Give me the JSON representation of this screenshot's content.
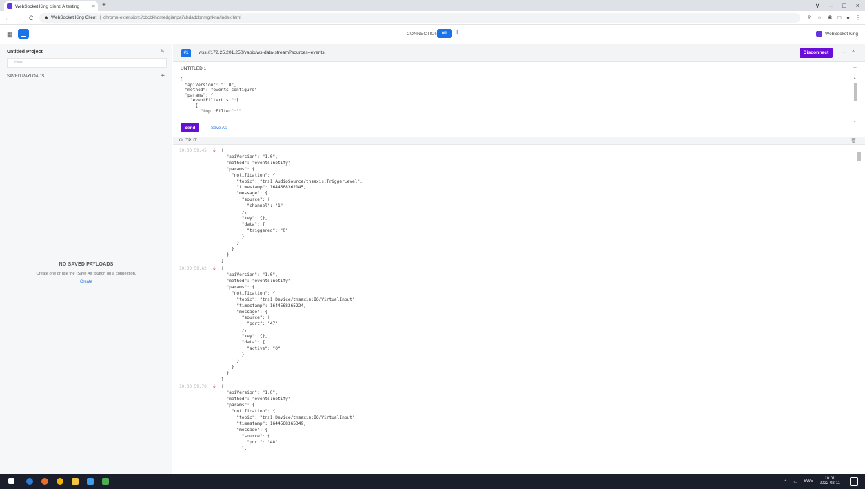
{
  "browser": {
    "tab_title": "WebSocket King client: A testing",
    "tab_close": "×",
    "new_tab": "+",
    "window_controls": [
      "∨",
      "–",
      "□",
      "×"
    ],
    "page_title": "WebSocket King Client",
    "separator": "|",
    "url": "chrome-extension://cbcbkhdmedgianpaifchdaddpnmgnknn/index.html"
  },
  "app": {
    "connections_label": "CONNECTIONS",
    "active_connection": "#1",
    "add_connection": "+",
    "brand": "WebSocket King"
  },
  "sidebar": {
    "project_title": "Untitled Project",
    "filter_placeholder": "Filter",
    "saved_payloads_title": "SAVED PAYLOADS",
    "saved_add": "+",
    "empty_title": "NO SAVED PAYLOADS",
    "empty_desc": "Create one or use the \"Save As\" button on a connection.",
    "create_label": "Create"
  },
  "connection": {
    "number": "#1",
    "url": "wss://172.25.201.250/vapix/ws-data-stream?sources=events",
    "disconnect_label": "Disconnect",
    "minimize": "–",
    "close": "×"
  },
  "editor": {
    "payload_name": "UNTITLED 1",
    "add": "+",
    "code": "{\n  \"apiVersion\": \"1.0\",\n  \"method\": \"events:configure\",\n  \"params\": {\n    \"eventFilterList\":[\n      {\n        \"topicFilter\":\"\"",
    "send_label": "Send",
    "save_as_label": "Save As"
  },
  "output": {
    "title": "OUTPUT",
    "messages": [
      {
        "time": "10:00 59.45",
        "body": "{\n  \"apiVersion\": \"1.0\",\n  \"method\": \"events:notify\",\n  \"params\": {\n    \"notification\": {\n      \"topic\": \"tns1:AudioSource/tnsaxis:TriggerLevel\",\n      \"timestamp\": 1644568362145,\n      \"message\": {\n        \"source\": {\n          \"channel\": \"1\"\n        },\n        \"key\": {},\n        \"data\": {\n          \"triggered\": \"0\"\n        }\n      }\n    }\n  }\n}"
      },
      {
        "time": "10:00 59.62",
        "body": "{\n  \"apiVersion\": \"1.0\",\n  \"method\": \"events:notify\",\n  \"params\": {\n    \"notification\": {\n      \"topic\": \"tns1:Device/tnsaxis:IO/VirtualInput\",\n      \"timestamp\": 1644568365224,\n      \"message\": {\n        \"source\": {\n          \"port\": \"47\"\n        },\n        \"key\": {},\n        \"data\": {\n          \"active\": \"0\"\n        }\n      }\n    }\n  }\n}"
      },
      {
        "time": "10:00 59.70",
        "body": "{\n  \"apiVersion\": \"1.0\",\n  \"method\": \"events:notify\",\n  \"params\": {\n    \"notification\": {\n      \"topic\": \"tns1:Device/tnsaxis:IO/VirtualInput\",\n      \"timestamp\": 1644568365349,\n      \"message\": {\n        \"source\": {\n          \"port\": \"48\"\n        },"
      }
    ]
  },
  "taskbar": {
    "language": "SWE",
    "time": "10:01",
    "date": "2022-02-11"
  },
  "colors": {
    "accent": "#1a73e8",
    "primary_button": "#6a0dd8",
    "incoming_arrow": "#e53935"
  }
}
